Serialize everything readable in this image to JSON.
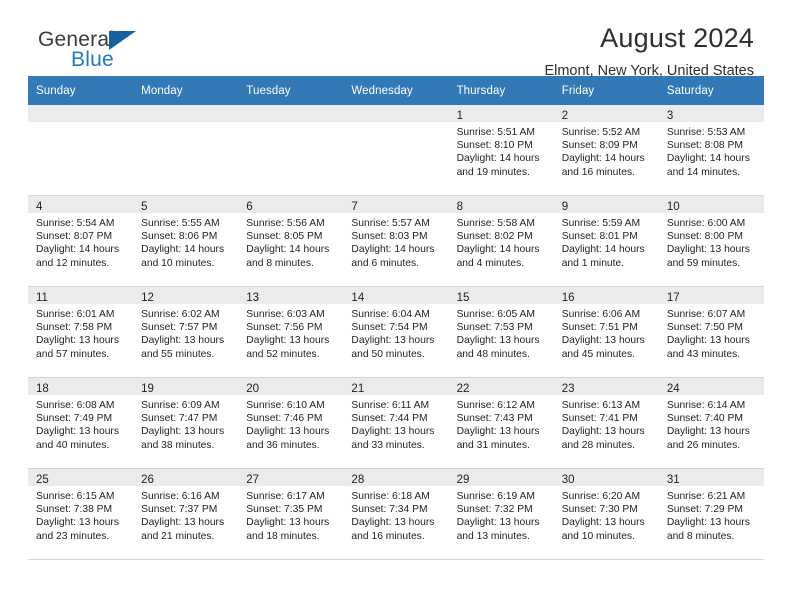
{
  "brand": {
    "name_part1": "General",
    "name_part2": "Blue",
    "accent_color": "#1f7bc1",
    "triangle_color": "#1462a0",
    "logo_icon": "blue-triangle-icon"
  },
  "header": {
    "title": "August 2024",
    "subtitle": "Elmont, New York, United States"
  },
  "calendar": {
    "header_bg": "#3479b7",
    "header_text_color": "#ffffff",
    "daynum_strip_bg": "#ebebeb",
    "grid_line_color": "#cfd6dd",
    "weekdays": [
      "Sunday",
      "Monday",
      "Tuesday",
      "Wednesday",
      "Thursday",
      "Friday",
      "Saturday"
    ],
    "weeks": [
      [
        {
          "day": "",
          "lines": []
        },
        {
          "day": "",
          "lines": []
        },
        {
          "day": "",
          "lines": []
        },
        {
          "day": "",
          "lines": []
        },
        {
          "day": "1",
          "lines": [
            "Sunrise: 5:51 AM",
            "Sunset: 8:10 PM",
            "Daylight: 14 hours",
            "and 19 minutes."
          ]
        },
        {
          "day": "2",
          "lines": [
            "Sunrise: 5:52 AM",
            "Sunset: 8:09 PM",
            "Daylight: 14 hours",
            "and 16 minutes."
          ]
        },
        {
          "day": "3",
          "lines": [
            "Sunrise: 5:53 AM",
            "Sunset: 8:08 PM",
            "Daylight: 14 hours",
            "and 14 minutes."
          ]
        }
      ],
      [
        {
          "day": "4",
          "lines": [
            "Sunrise: 5:54 AM",
            "Sunset: 8:07 PM",
            "Daylight: 14 hours",
            "and 12 minutes."
          ]
        },
        {
          "day": "5",
          "lines": [
            "Sunrise: 5:55 AM",
            "Sunset: 8:06 PM",
            "Daylight: 14 hours",
            "and 10 minutes."
          ]
        },
        {
          "day": "6",
          "lines": [
            "Sunrise: 5:56 AM",
            "Sunset: 8:05 PM",
            "Daylight: 14 hours",
            "and 8 minutes."
          ]
        },
        {
          "day": "7",
          "lines": [
            "Sunrise: 5:57 AM",
            "Sunset: 8:03 PM",
            "Daylight: 14 hours",
            "and 6 minutes."
          ]
        },
        {
          "day": "8",
          "lines": [
            "Sunrise: 5:58 AM",
            "Sunset: 8:02 PM",
            "Daylight: 14 hours",
            "and 4 minutes."
          ]
        },
        {
          "day": "9",
          "lines": [
            "Sunrise: 5:59 AM",
            "Sunset: 8:01 PM",
            "Daylight: 14 hours",
            "and 1 minute."
          ]
        },
        {
          "day": "10",
          "lines": [
            "Sunrise: 6:00 AM",
            "Sunset: 8:00 PM",
            "Daylight: 13 hours",
            "and 59 minutes."
          ]
        }
      ],
      [
        {
          "day": "11",
          "lines": [
            "Sunrise: 6:01 AM",
            "Sunset: 7:58 PM",
            "Daylight: 13 hours",
            "and 57 minutes."
          ]
        },
        {
          "day": "12",
          "lines": [
            "Sunrise: 6:02 AM",
            "Sunset: 7:57 PM",
            "Daylight: 13 hours",
            "and 55 minutes."
          ]
        },
        {
          "day": "13",
          "lines": [
            "Sunrise: 6:03 AM",
            "Sunset: 7:56 PM",
            "Daylight: 13 hours",
            "and 52 minutes."
          ]
        },
        {
          "day": "14",
          "lines": [
            "Sunrise: 6:04 AM",
            "Sunset: 7:54 PM",
            "Daylight: 13 hours",
            "and 50 minutes."
          ]
        },
        {
          "day": "15",
          "lines": [
            "Sunrise: 6:05 AM",
            "Sunset: 7:53 PM",
            "Daylight: 13 hours",
            "and 48 minutes."
          ]
        },
        {
          "day": "16",
          "lines": [
            "Sunrise: 6:06 AM",
            "Sunset: 7:51 PM",
            "Daylight: 13 hours",
            "and 45 minutes."
          ]
        },
        {
          "day": "17",
          "lines": [
            "Sunrise: 6:07 AM",
            "Sunset: 7:50 PM",
            "Daylight: 13 hours",
            "and 43 minutes."
          ]
        }
      ],
      [
        {
          "day": "18",
          "lines": [
            "Sunrise: 6:08 AM",
            "Sunset: 7:49 PM",
            "Daylight: 13 hours",
            "and 40 minutes."
          ]
        },
        {
          "day": "19",
          "lines": [
            "Sunrise: 6:09 AM",
            "Sunset: 7:47 PM",
            "Daylight: 13 hours",
            "and 38 minutes."
          ]
        },
        {
          "day": "20",
          "lines": [
            "Sunrise: 6:10 AM",
            "Sunset: 7:46 PM",
            "Daylight: 13 hours",
            "and 36 minutes."
          ]
        },
        {
          "day": "21",
          "lines": [
            "Sunrise: 6:11 AM",
            "Sunset: 7:44 PM",
            "Daylight: 13 hours",
            "and 33 minutes."
          ]
        },
        {
          "day": "22",
          "lines": [
            "Sunrise: 6:12 AM",
            "Sunset: 7:43 PM",
            "Daylight: 13 hours",
            "and 31 minutes."
          ]
        },
        {
          "day": "23",
          "lines": [
            "Sunrise: 6:13 AM",
            "Sunset: 7:41 PM",
            "Daylight: 13 hours",
            "and 28 minutes."
          ]
        },
        {
          "day": "24",
          "lines": [
            "Sunrise: 6:14 AM",
            "Sunset: 7:40 PM",
            "Daylight: 13 hours",
            "and 26 minutes."
          ]
        }
      ],
      [
        {
          "day": "25",
          "lines": [
            "Sunrise: 6:15 AM",
            "Sunset: 7:38 PM",
            "Daylight: 13 hours",
            "and 23 minutes."
          ]
        },
        {
          "day": "26",
          "lines": [
            "Sunrise: 6:16 AM",
            "Sunset: 7:37 PM",
            "Daylight: 13 hours",
            "and 21 minutes."
          ]
        },
        {
          "day": "27",
          "lines": [
            "Sunrise: 6:17 AM",
            "Sunset: 7:35 PM",
            "Daylight: 13 hours",
            "and 18 minutes."
          ]
        },
        {
          "day": "28",
          "lines": [
            "Sunrise: 6:18 AM",
            "Sunset: 7:34 PM",
            "Daylight: 13 hours",
            "and 16 minutes."
          ]
        },
        {
          "day": "29",
          "lines": [
            "Sunrise: 6:19 AM",
            "Sunset: 7:32 PM",
            "Daylight: 13 hours",
            "and 13 minutes."
          ]
        },
        {
          "day": "30",
          "lines": [
            "Sunrise: 6:20 AM",
            "Sunset: 7:30 PM",
            "Daylight: 13 hours",
            "and 10 minutes."
          ]
        },
        {
          "day": "31",
          "lines": [
            "Sunrise: 6:21 AM",
            "Sunset: 7:29 PM",
            "Daylight: 13 hours",
            "and 8 minutes."
          ]
        }
      ]
    ]
  }
}
